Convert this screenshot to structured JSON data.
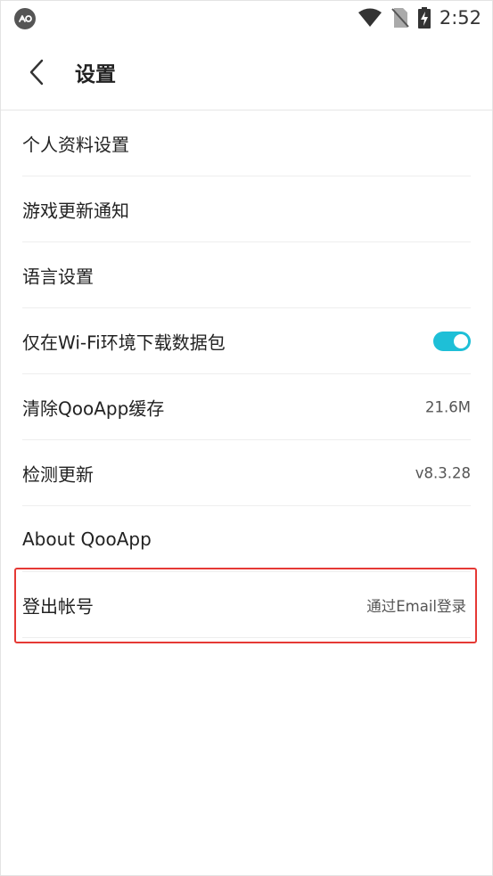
{
  "status_bar": {
    "time": "2:52",
    "icons": [
      "app-badge-icon",
      "wifi-icon",
      "no-sim-icon",
      "battery-charging-icon"
    ]
  },
  "header": {
    "title": "设置",
    "back_icon": "chevron-left-icon"
  },
  "settings": [
    {
      "label": "个人资料设置"
    },
    {
      "label": "游戏更新通知"
    },
    {
      "label": "语言设置"
    },
    {
      "label": "仅在Wi-Fi环境下载数据包",
      "toggle": true
    },
    {
      "label": "清除QooApp缓存",
      "value": "21.6M"
    },
    {
      "label": "检测更新",
      "value": "v8.3.28"
    },
    {
      "label": "About QooApp"
    },
    {
      "label": "登出帐号",
      "value": "通过Email登录"
    }
  ],
  "colors": {
    "accent": "#1ebfd7",
    "highlight": "#e53935",
    "divider": "#eeeeee",
    "text": "#222222"
  }
}
